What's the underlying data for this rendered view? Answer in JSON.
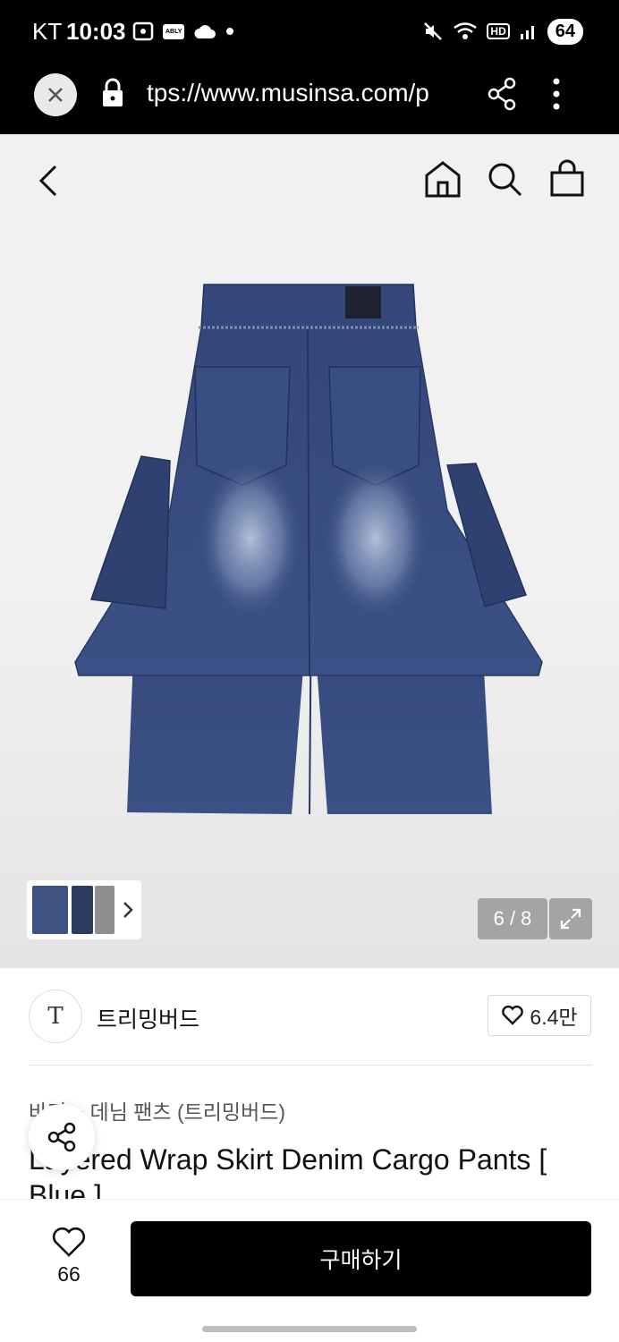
{
  "status_bar": {
    "carrier": "KT",
    "time": "10:03",
    "battery": "64",
    "hd_label": "HD",
    "app_badge": "ABLY"
  },
  "browser": {
    "url": "tps://www.musinsa.com/p"
  },
  "gallery": {
    "counter": "6 / 8",
    "current_image": 6,
    "total_images": 8
  },
  "brand": {
    "logo_text": "T",
    "name": "트리밍버드",
    "like_count": "6.4만"
  },
  "product": {
    "category": "바지 > 데님 팬츠 (트리밍버드)",
    "title": "Layered Wrap Skirt Denim Cargo Pants [ Blue ]"
  },
  "purchase_bar": {
    "like_count": "66",
    "buy_label": "구매하기"
  },
  "colors": {
    "denim": "#3b5286",
    "denim_dark": "#2b3d68",
    "button_bg": "#000000"
  }
}
